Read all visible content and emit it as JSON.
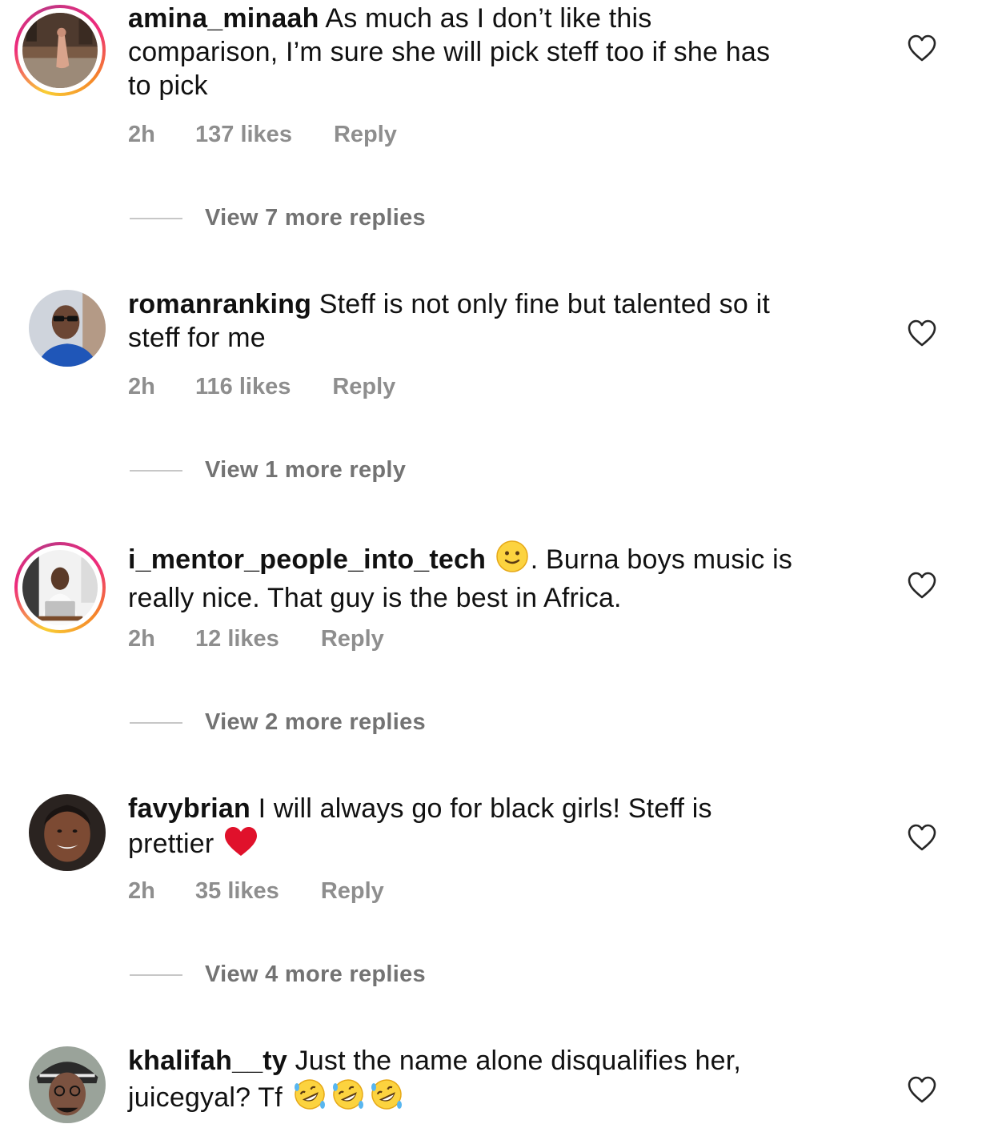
{
  "comments": [
    {
      "username": "amina_minaah",
      "text_lines": [
        "As much as I don’t like this",
        "comparison, I’m sure she will pick steff too if she has",
        "to pick"
      ],
      "time": "2h",
      "likes": "137 likes",
      "reply": "Reply",
      "view_replies": "View 7 more replies",
      "story_ring": true,
      "avatar_icon": "avatar-photo-woman-street"
    },
    {
      "username": "romanranking",
      "text_lines": [
        "Steff is not only fine but talented so it",
        "steff for me"
      ],
      "time": "2h",
      "likes": "116 likes",
      "reply": "Reply",
      "view_replies": "View 1 more reply",
      "story_ring": false,
      "avatar_icon": "avatar-photo-man-sunglasses"
    },
    {
      "username": "i_mentor_people_into_tech",
      "text_before_emoji": "",
      "emoji": "slightly-smiling-face-emoji",
      "text_lines": [
        ". Burna boys music is",
        "really nice. That guy is the best in Africa."
      ],
      "time": "2h",
      "likes": "12 likes",
      "reply": "Reply",
      "view_replies": "View 2 more replies",
      "story_ring": true,
      "avatar_icon": "avatar-photo-man-laptop"
    },
    {
      "username": "favybrian",
      "text_lines": [
        "I will always go for black girls! Steff is",
        "prettier"
      ],
      "emoji": "red-heart-emoji",
      "time": "2h",
      "likes": "35 likes",
      "reply": "Reply",
      "view_replies": "View 4 more replies",
      "story_ring": false,
      "avatar_icon": "avatar-photo-woman-smiling"
    },
    {
      "username": "khalifah__ty",
      "text_lines": [
        "Just the name alone disqualifies her,",
        "juicegyal? Tf"
      ],
      "emoji": "rolling-on-floor-laughing-emoji",
      "emoji_count": 3,
      "story_ring": false,
      "avatar_icon": "avatar-photo-man-cap"
    }
  ],
  "colors": {
    "meta_gray": "#8e8e8e",
    "text": "#111111",
    "story_ring_start": "#f9ce34",
    "story_ring_end": "#ee2a7b",
    "heart_emoji": "#e0112b"
  },
  "icons": {
    "like": "heart-outline-icon"
  }
}
